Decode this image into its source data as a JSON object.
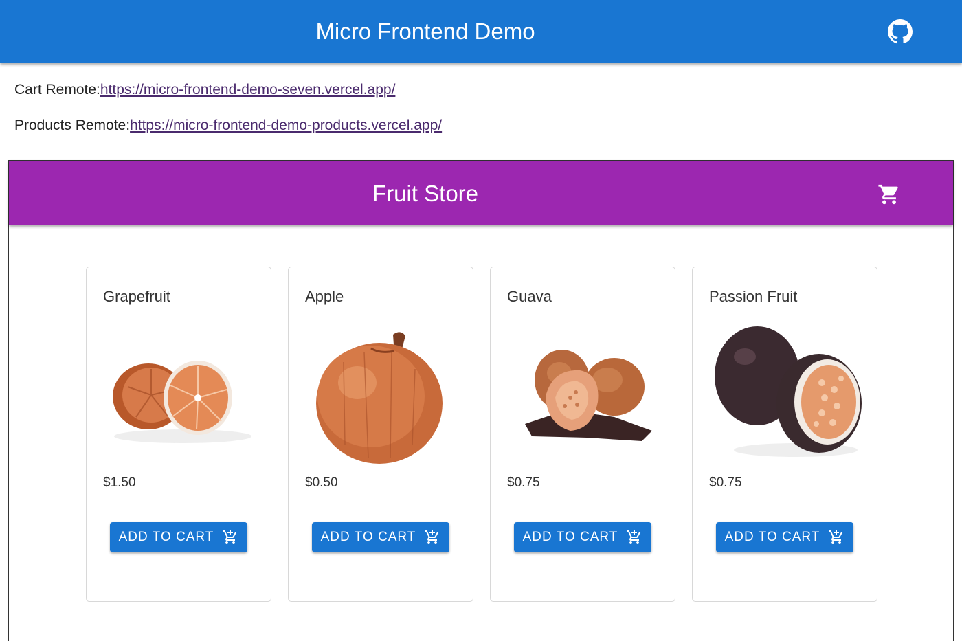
{
  "header": {
    "title": "Micro Frontend Demo",
    "github_icon": "github-icon",
    "color": "#1976d2"
  },
  "remotes": [
    {
      "label": "Cart Remote:",
      "url": "https://micro-frontend-demo-seven.vercel.app/"
    },
    {
      "label": "Products Remote:",
      "url": "https://micro-frontend-demo-products.vercel.app/"
    }
  ],
  "store": {
    "title": "Fruit Store",
    "cart_icon": "shopping-cart-icon",
    "color": "#9c27b0"
  },
  "products": [
    {
      "name": "Grapefruit",
      "price": "$1.50",
      "button": "ADD TO CART",
      "image": "grapefruit-image"
    },
    {
      "name": "Apple",
      "price": "$0.50",
      "button": "ADD TO CART",
      "image": "apple-image"
    },
    {
      "name": "Guava",
      "price": "$0.75",
      "button": "ADD TO CART",
      "image": "guava-image"
    },
    {
      "name": "Passion Fruit",
      "price": "$0.75",
      "button": "ADD TO CART",
      "image": "passion-fruit-image"
    }
  ]
}
